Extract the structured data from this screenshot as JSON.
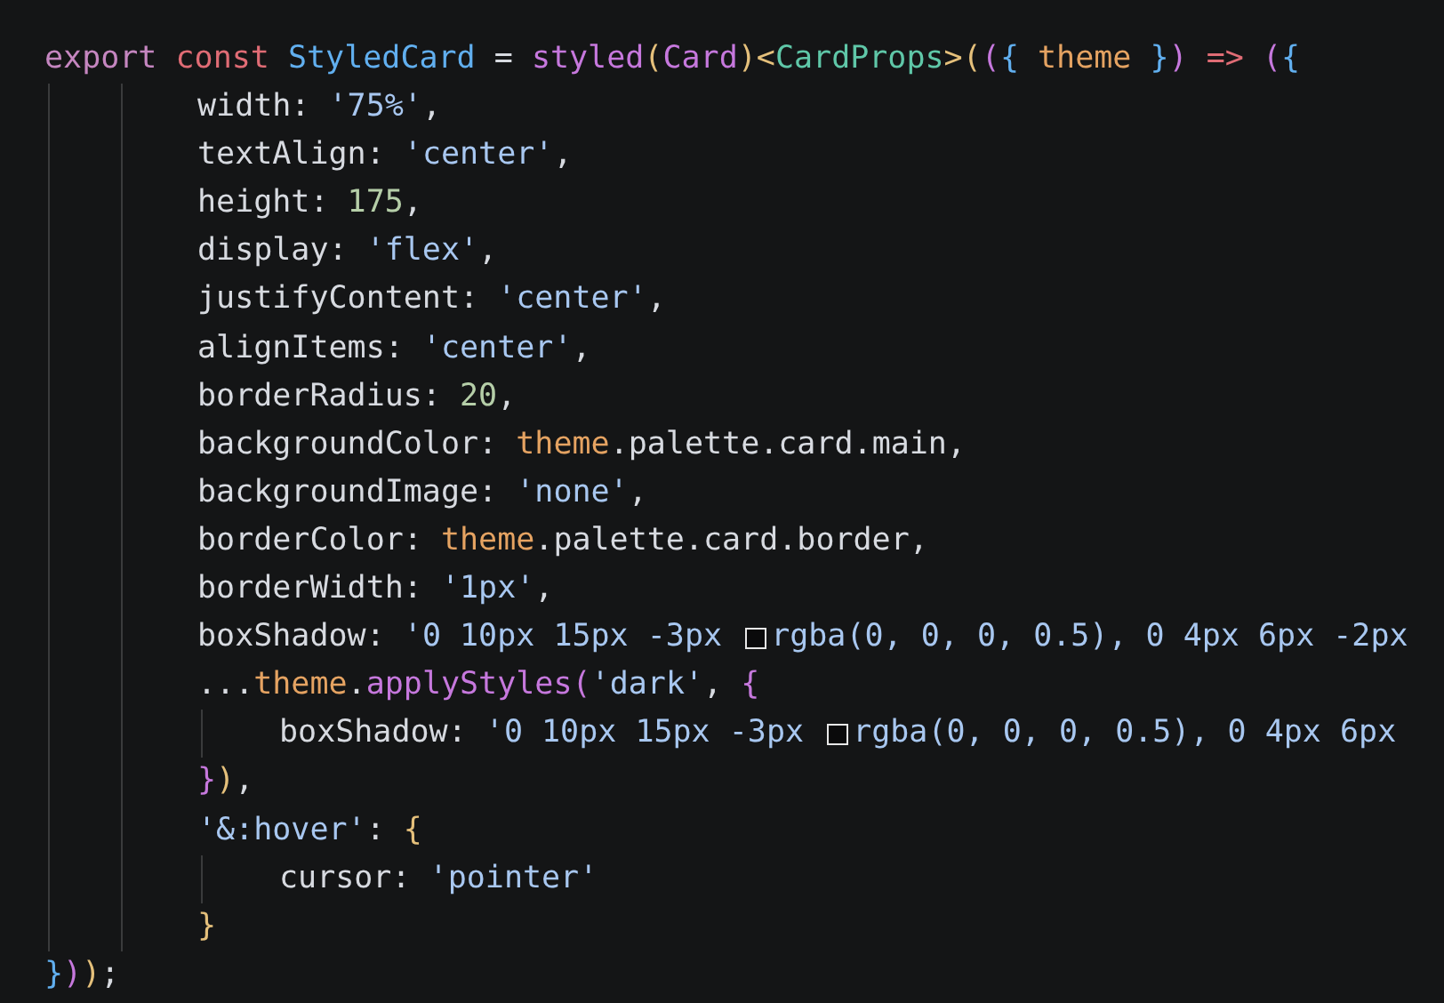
{
  "editor": {
    "lines": [
      {
        "tokens": [
          {
            "kind": "text",
            "text": "export ",
            "color": "#c586c0"
          },
          {
            "kind": "text",
            "text": "const ",
            "color": "#e06c75"
          },
          {
            "kind": "text",
            "text": "StyledCard",
            "color": "#61afef"
          },
          {
            "kind": "text",
            "text": " = ",
            "color": "#d7dae0"
          },
          {
            "kind": "text",
            "text": "styled",
            "color": "#c678dd"
          },
          {
            "kind": "text",
            "text": "(",
            "color": "#e5c07b"
          },
          {
            "kind": "text",
            "text": "Card",
            "color": "#c678dd"
          },
          {
            "kind": "text",
            "text": ")",
            "color": "#e5c07b"
          },
          {
            "kind": "text",
            "text": "<",
            "color": "#e5c07b"
          },
          {
            "kind": "text",
            "text": "CardProps",
            "color": "#5fc7a8"
          },
          {
            "kind": "text",
            "text": ">",
            "color": "#e5c07b"
          },
          {
            "kind": "text",
            "text": "(",
            "color": "#e5c07b"
          },
          {
            "kind": "text",
            "text": "(",
            "color": "#c678dd"
          },
          {
            "kind": "text",
            "text": "{",
            "color": "#61afef"
          },
          {
            "kind": "text",
            "text": " theme ",
            "color": "#e5a362"
          },
          {
            "kind": "text",
            "text": "}",
            "color": "#61afef"
          },
          {
            "kind": "text",
            "text": ") ",
            "color": "#c678dd"
          },
          {
            "kind": "text",
            "text": "=> ",
            "color": "#e06c75"
          },
          {
            "kind": "text",
            "text": "(",
            "color": "#c678dd"
          },
          {
            "kind": "text",
            "text": "{",
            "color": "#61afef"
          }
        ],
        "children": [
          {
            "tokens": [
              {
                "kind": "text",
                "text": "width: ",
                "color": "#d7dae0"
              },
              {
                "kind": "text",
                "text": "'75%'",
                "color": "#a8c7f0"
              },
              {
                "kind": "text",
                "text": ",",
                "color": "#d7dae0"
              }
            ]
          },
          {
            "tokens": [
              {
                "kind": "text",
                "text": "textAlign: ",
                "color": "#d7dae0"
              },
              {
                "kind": "text",
                "text": "'center'",
                "color": "#a8c7f0"
              },
              {
                "kind": "text",
                "text": ",",
                "color": "#d7dae0"
              }
            ]
          },
          {
            "tokens": [
              {
                "kind": "text",
                "text": "height: ",
                "color": "#d7dae0"
              },
              {
                "kind": "text",
                "text": "175",
                "color": "#b5cea8"
              },
              {
                "kind": "text",
                "text": ",",
                "color": "#d7dae0"
              }
            ]
          },
          {
            "tokens": [
              {
                "kind": "text",
                "text": "display: ",
                "color": "#d7dae0"
              },
              {
                "kind": "text",
                "text": "'flex'",
                "color": "#a8c7f0"
              },
              {
                "kind": "text",
                "text": ",",
                "color": "#d7dae0"
              }
            ]
          },
          {
            "tokens": [
              {
                "kind": "text",
                "text": "justifyContent: ",
                "color": "#d7dae0"
              },
              {
                "kind": "text",
                "text": "'center'",
                "color": "#a8c7f0"
              },
              {
                "kind": "text",
                "text": ",",
                "color": "#d7dae0"
              }
            ]
          },
          {
            "tokens": [
              {
                "kind": "text",
                "text": "alignItems: ",
                "color": "#d7dae0"
              },
              {
                "kind": "text",
                "text": "'center'",
                "color": "#a8c7f0"
              },
              {
                "kind": "text",
                "text": ",",
                "color": "#d7dae0"
              }
            ]
          },
          {
            "tokens": [
              {
                "kind": "text",
                "text": "borderRadius: ",
                "color": "#d7dae0"
              },
              {
                "kind": "text",
                "text": "20",
                "color": "#b5cea8"
              },
              {
                "kind": "text",
                "text": ",",
                "color": "#d7dae0"
              }
            ]
          },
          {
            "tokens": [
              {
                "kind": "text",
                "text": "backgroundColor: ",
                "color": "#d7dae0"
              },
              {
                "kind": "text",
                "text": "theme",
                "color": "#e5a362"
              },
              {
                "kind": "text",
                "text": ".palette.card.main,",
                "color": "#d7dae0"
              }
            ]
          },
          {
            "tokens": [
              {
                "kind": "text",
                "text": "backgroundImage: ",
                "color": "#d7dae0"
              },
              {
                "kind": "text",
                "text": "'none'",
                "color": "#a8c7f0"
              },
              {
                "kind": "text",
                "text": ",",
                "color": "#d7dae0"
              }
            ]
          },
          {
            "tokens": [
              {
                "kind": "text",
                "text": "borderColor: ",
                "color": "#d7dae0"
              },
              {
                "kind": "text",
                "text": "theme",
                "color": "#e5a362"
              },
              {
                "kind": "text",
                "text": ".palette.card.border,",
                "color": "#d7dae0"
              }
            ]
          },
          {
            "tokens": [
              {
                "kind": "text",
                "text": "borderWidth: ",
                "color": "#d7dae0"
              },
              {
                "kind": "text",
                "text": "'1px'",
                "color": "#a8c7f0"
              },
              {
                "kind": "text",
                "text": ",",
                "color": "#d7dae0"
              }
            ]
          },
          {
            "tokens": [
              {
                "kind": "text",
                "text": "boxShadow: ",
                "color": "#d7dae0"
              },
              {
                "kind": "text",
                "text": "'0 10px 15px -3px ",
                "color": "#a8c7f0"
              },
              {
                "kind": "swatch"
              },
              {
                "kind": "text",
                "text": "rgba(0, 0, 0, 0.5), 0 4px 6px -2px",
                "color": "#a8c7f0"
              }
            ]
          },
          {
            "tokens": [
              {
                "kind": "text",
                "text": "...",
                "color": "#d7dae0"
              },
              {
                "kind": "text",
                "text": "theme",
                "color": "#e5a362"
              },
              {
                "kind": "text",
                "text": ".",
                "color": "#d7dae0"
              },
              {
                "kind": "text",
                "text": "applyStyles",
                "color": "#c678dd"
              },
              {
                "kind": "text",
                "text": "(",
                "color": "#c678dd"
              },
              {
                "kind": "text",
                "text": "'dark'",
                "color": "#a8c7f0"
              },
              {
                "kind": "text",
                "text": ", ",
                "color": "#d7dae0"
              },
              {
                "kind": "text",
                "text": "{",
                "color": "#c678dd"
              }
            ],
            "children": [
              {
                "tokens": [
                  {
                    "kind": "text",
                    "text": "boxShadow: ",
                    "color": "#d7dae0"
                  },
                  {
                    "kind": "text",
                    "text": "'0 10px 15px -3px ",
                    "color": "#a8c7f0"
                  },
                  {
                    "kind": "swatch"
                  },
                  {
                    "kind": "text",
                    "text": "rgba(0, 0, 0, 0.5), 0 4px 6px",
                    "color": "#a8c7f0"
                  }
                ]
              }
            ]
          },
          {
            "tokens": [
              {
                "kind": "text",
                "text": "}",
                "color": "#c678dd"
              },
              {
                "kind": "text",
                "text": ")",
                "color": "#e5c07b"
              },
              {
                "kind": "text",
                "text": ",",
                "color": "#d7dae0"
              }
            ]
          },
          {
            "tokens": [
              {
                "kind": "text",
                "text": "'&:hover'",
                "color": "#a8c7f0"
              },
              {
                "kind": "text",
                "text": ": ",
                "color": "#d7dae0"
              },
              {
                "kind": "text",
                "text": "{",
                "color": "#e5c07b"
              }
            ],
            "children": [
              {
                "tokens": [
                  {
                    "kind": "text",
                    "text": "cursor: ",
                    "color": "#d7dae0"
                  },
                  {
                    "kind": "text",
                    "text": "'pointer'",
                    "color": "#a8c7f0"
                  }
                ]
              }
            ]
          },
          {
            "tokens": [
              {
                "kind": "text",
                "text": "}",
                "color": "#e5c07b"
              }
            ]
          }
        ]
      },
      {
        "tokens": [
          {
            "kind": "text",
            "text": "}",
            "color": "#61afef"
          },
          {
            "kind": "text",
            "text": ")",
            "color": "#c678dd"
          },
          {
            "kind": "text",
            "text": ")",
            "color": "#e5c07b"
          },
          {
            "kind": "text",
            "text": ";",
            "color": "#d7dae0"
          }
        ]
      }
    ]
  }
}
